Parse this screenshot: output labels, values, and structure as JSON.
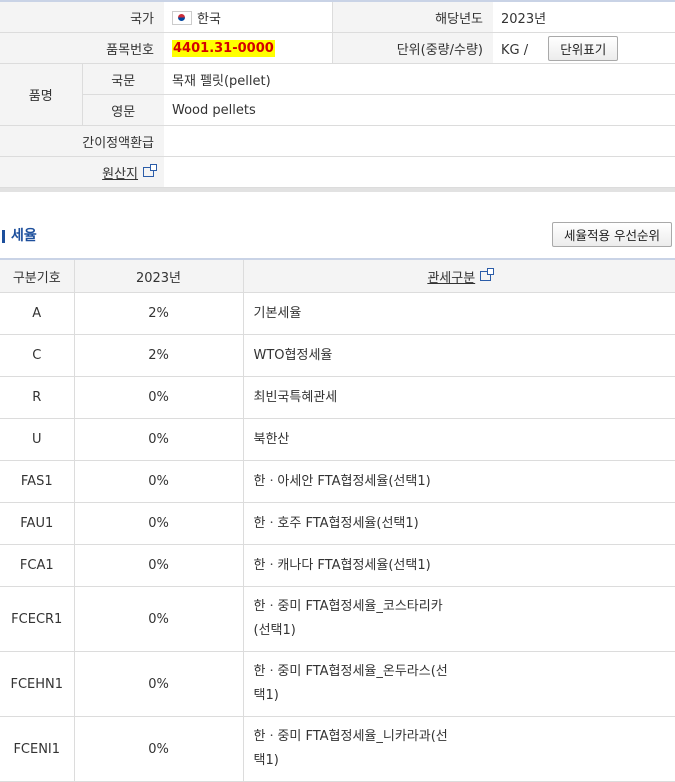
{
  "info": {
    "country_label": "국가",
    "country_value": "한국",
    "year_label": "해당년도",
    "year_value": "2023년",
    "hs_label": "품목번호",
    "hs_value": "4401.31-0000",
    "unit_label": "단위(중량/수량)",
    "unit_value": "KG /",
    "unit_button": "단위표기",
    "name_label": "품명",
    "kor_label": "국문",
    "kor_value": "목재 펠릿(pellet)",
    "eng_label": "영문",
    "eng_value": "Wood pellets",
    "refund_label": "간이정액환급",
    "refund_value": "",
    "origin_label": "원산지",
    "origin_value": ""
  },
  "section": {
    "title": "세율",
    "priority_button": "세율적용 우선순위"
  },
  "rates": {
    "headers": [
      "구분기호",
      "2023년",
      "관세구분"
    ],
    "rows": [
      {
        "code": "A",
        "rate": "2%",
        "desc": "기본세율"
      },
      {
        "code": "C",
        "rate": "2%",
        "desc": "WTO협정세율"
      },
      {
        "code": "R",
        "rate": "0%",
        "desc": "최빈국특혜관세"
      },
      {
        "code": "U",
        "rate": "0%",
        "desc": "북한산"
      },
      {
        "code": "FAS1",
        "rate": "0%",
        "desc": "한ㆍ아세안 FTA협정세율(선택1)"
      },
      {
        "code": "FAU1",
        "rate": "0%",
        "desc": "한ㆍ호주 FTA협정세율(선택1)"
      },
      {
        "code": "FCA1",
        "rate": "0%",
        "desc": "한ㆍ캐나다 FTA협정세율(선택1)"
      },
      {
        "code": "FCECR1",
        "rate": "0%",
        "desc_line1": "한ㆍ중미 FTA협정세율_코스타리카",
        "desc_line2": "(선택1)"
      },
      {
        "code": "FCEHN1",
        "rate": "0%",
        "desc_line1": "한ㆍ중미 FTA협정세율_온두라스(선",
        "desc_line2": "택1)"
      },
      {
        "code": "FCENI1",
        "rate": "0%",
        "desc_line1": "한ㆍ중미 FTA협정세율_니카라과(선",
        "desc_line2": "택1)"
      }
    ]
  }
}
